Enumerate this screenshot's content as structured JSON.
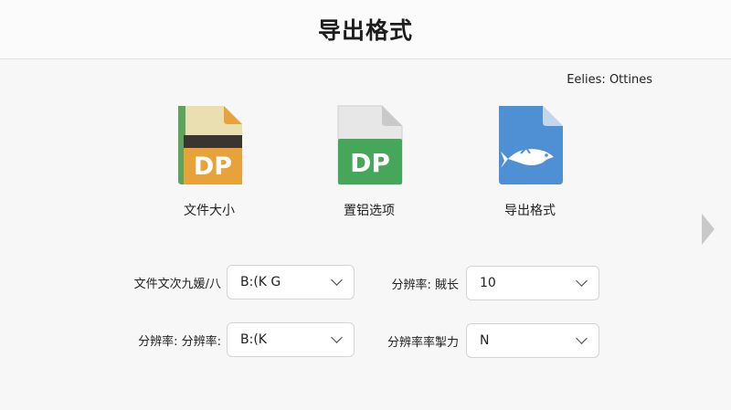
{
  "header": {
    "title": "导出格式"
  },
  "top_right": {
    "label": "Eelies: Ottines"
  },
  "format_options": [
    {
      "caption": "文件大小",
      "icon": "dp-file-orange-icon",
      "icon_text": "DP",
      "color": "#e8a23a"
    },
    {
      "caption": "置铝选项",
      "icon": "dp-file-green-icon",
      "icon_text": "DP",
      "color": "#46a65a"
    },
    {
      "caption": "导出格式",
      "icon": "fish-file-blue-icon",
      "icon_text": "",
      "color": "#4f8fd4"
    }
  ],
  "form": {
    "row1_left": {
      "label": "文件文次九媛/八",
      "value": "B:(K G"
    },
    "row2_left": {
      "label": "分辨率: 分辨率:",
      "value": "B:(K"
    },
    "row1_right": {
      "label": "分辨率: 賊长",
      "value": "10"
    },
    "row2_right": {
      "label": "分辨率率掣力",
      "value": "N"
    }
  }
}
